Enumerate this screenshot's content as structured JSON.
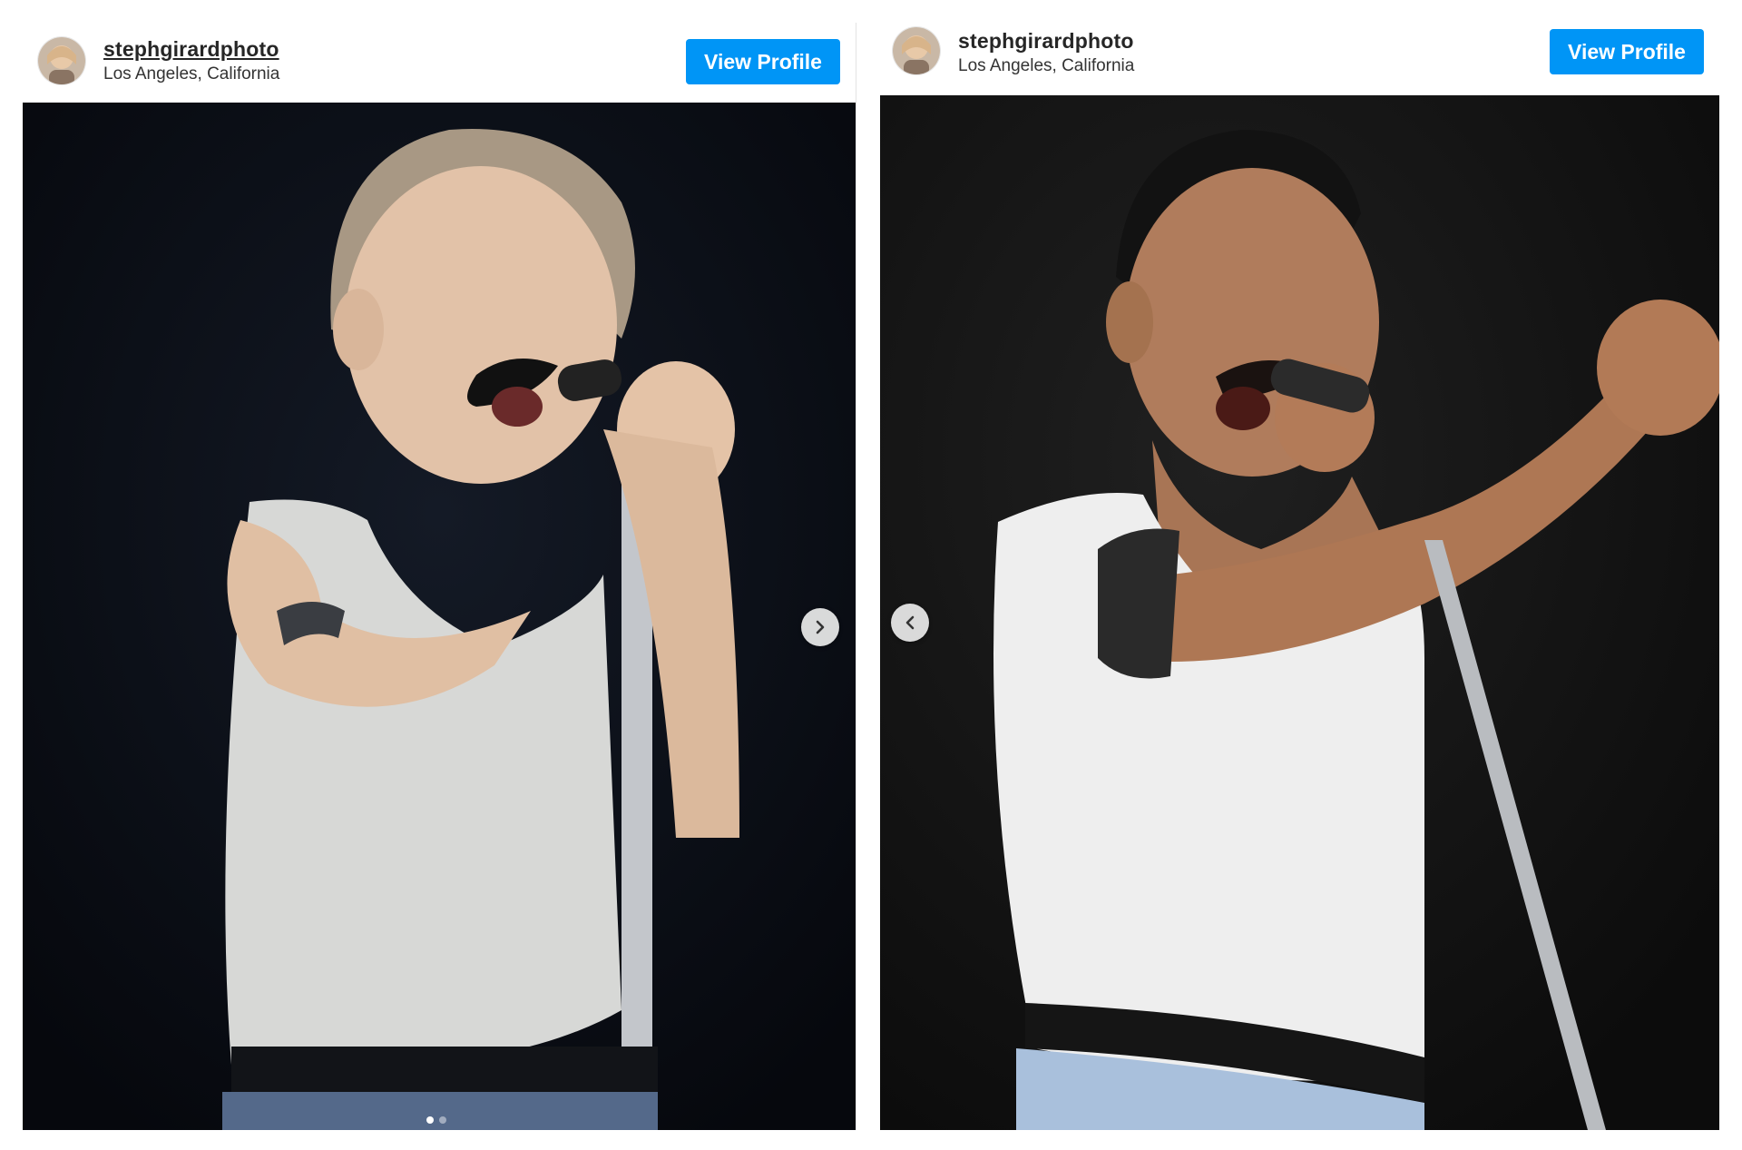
{
  "left_post": {
    "username": "stephgirardphoto",
    "location": "Los Angeles, California",
    "view_profile_label": "View Profile",
    "next_icon": "chevron-right-icon",
    "carousel": {
      "total": 2,
      "active": 1
    }
  },
  "right_post": {
    "username": "stephgirardphoto",
    "location": "Los Angeles, California",
    "view_profile_label": "View Profile",
    "prev_icon": "chevron-left-icon"
  },
  "colors": {
    "button": "#0095f6",
    "left_photo_bg": "#0b0d14",
    "right_photo_bg": "#161616"
  }
}
